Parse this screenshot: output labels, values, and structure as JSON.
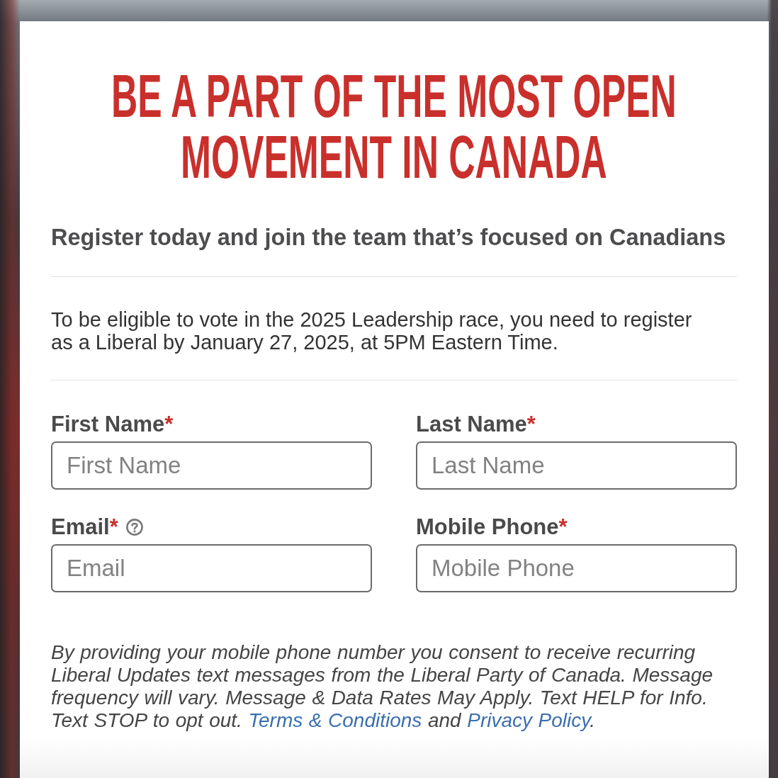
{
  "heading": "BE A PART OF THE MOST OPEN MOVEMENT IN CANADA",
  "subtitle": "Register today and join the team that’s focused on Canadians",
  "notice": "To be eligible to vote in the 2025 Leadership race, you need to register as a Liberal by January 27, 2025, at 5PM Eastern Time.",
  "fields": [
    {
      "label": "First Name",
      "required_mark": "*",
      "help": false,
      "placeholder": "First Name"
    },
    {
      "label": "Last Name",
      "required_mark": "*",
      "help": false,
      "placeholder": "Last Name"
    },
    {
      "label": "Email",
      "required_mark": "*",
      "help": true,
      "placeholder": "Email"
    },
    {
      "label": "Mobile Phone",
      "required_mark": "*",
      "help": false,
      "placeholder": "Mobile Phone"
    }
  ],
  "consent": [
    {
      "kind": "text",
      "text": "By providing your mobile phone number you consent to receive recurring Liberal Updates text messages from the Liberal Party of Canada. Message frequency will vary. Message & Data Rates May Apply. Text HELP for Info. Text STOP to opt out. "
    },
    {
      "kind": "link",
      "text": "Terms & Conditions"
    },
    {
      "kind": "text",
      "text": " and "
    },
    {
      "kind": "link",
      "text": "Privacy Policy"
    },
    {
      "kind": "text",
      "text": "."
    }
  ]
}
